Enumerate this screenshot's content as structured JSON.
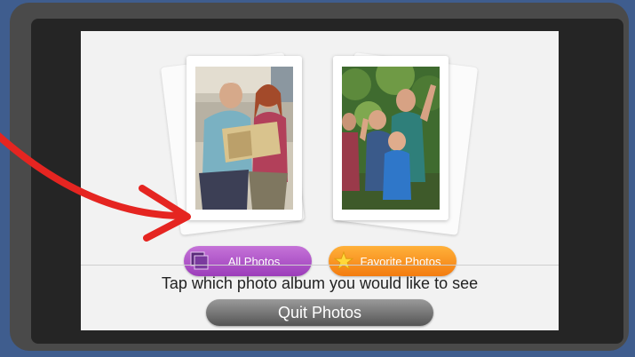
{
  "albums": [
    {
      "label": "All Photos",
      "icon": "photo-stack-icon",
      "color": "#b055cc"
    },
    {
      "label": "Favorite Photos",
      "icon": "star-icon",
      "color": "#f7901e"
    }
  ],
  "instruction": "Tap which photo album you would like to see",
  "quit_label": "Quit Photos",
  "annotation": {
    "type": "red-arrow",
    "color": "#e52521",
    "points_to": "All Photos"
  },
  "colors": {
    "background": "#3f5d8e",
    "tablet_frame": "#4a4a4a",
    "screen": "#f2f2f2"
  }
}
